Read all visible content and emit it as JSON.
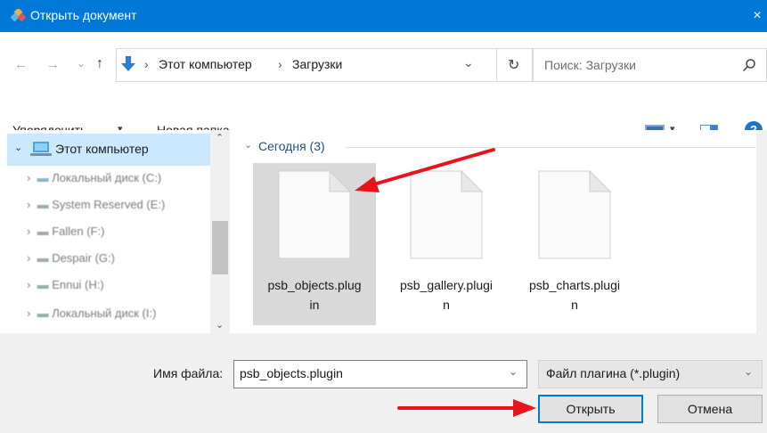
{
  "titlebar": {
    "title": "Открыть документ",
    "close": "×"
  },
  "address": {
    "back": "←",
    "forward": "→",
    "history": "⌄",
    "up": "↑",
    "path": [
      "Этот компьютер",
      "Загрузки"
    ],
    "separator": "›",
    "dropdown": "⌄",
    "refresh": "↻"
  },
  "search": {
    "placeholder": "Поиск: Загрузки"
  },
  "toolbar": {
    "organize": "Упорядочить",
    "organize_arrow": "▾",
    "new_folder": "Новая папка",
    "view_arrow": "▾",
    "help": "?"
  },
  "nav": {
    "root": "Этот компьютер",
    "items": [
      "Локальный диск (C:)",
      "System Reserved (E:)",
      "Fallen (F:)",
      "Despair (G:)",
      "Ennui (H:)",
      "Локальный диск (I:)"
    ]
  },
  "files": {
    "group": "Сегодня (3)",
    "items": [
      {
        "line1": "psb_objects.plug",
        "line2": "in"
      },
      {
        "line1": "psb_gallery.plugi",
        "line2": "n"
      },
      {
        "line1": "psb_charts.plugi",
        "line2": "n"
      }
    ]
  },
  "bottom": {
    "filename_label": "Имя файла:",
    "filename_value": "psb_objects.plugin",
    "filter_value": "Файл плагина (*.plugin)",
    "open": "Открыть",
    "cancel": "Отмена"
  },
  "colors": {
    "accent": "#0078d7",
    "selection": "#cce8ff",
    "annotation": "#e8141c"
  }
}
